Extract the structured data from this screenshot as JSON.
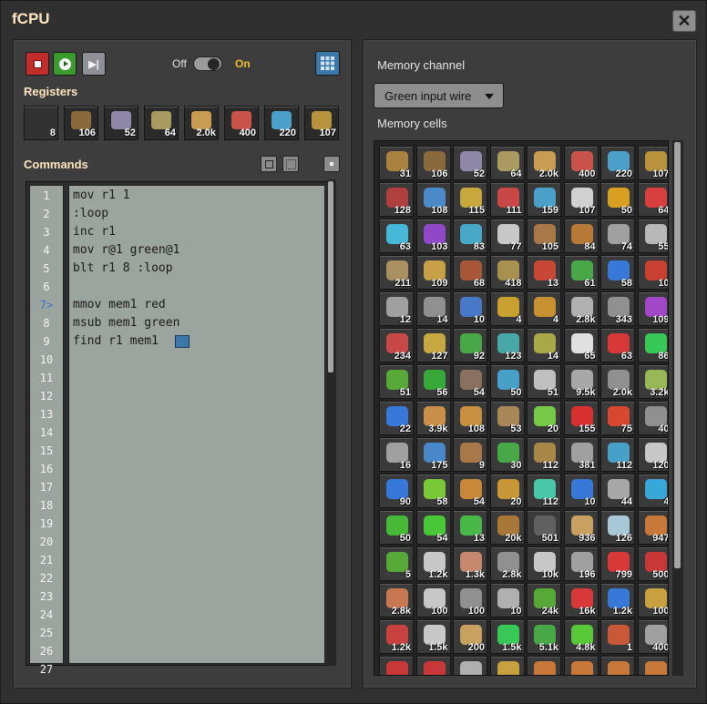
{
  "window": {
    "title": "fCPU",
    "close_label": "✕"
  },
  "controls": {
    "stop_icon": "stop-icon",
    "run_icon": "play-icon",
    "step_icon": "step-icon",
    "power_off": "Off",
    "power_on": "On",
    "power_state": "on",
    "layout_icon": "grid-icon"
  },
  "registers": {
    "heading": "Registers",
    "slots": [
      {
        "icon": "empty",
        "color": "#2a2a2a",
        "count": "8"
      },
      {
        "icon": "wooden-chest-icon",
        "color": "#8a6a3c",
        "count": "106"
      },
      {
        "icon": "steel-chest-icon",
        "color": "#8f88a8",
        "count": "52"
      },
      {
        "icon": "storage-tank-icon",
        "color": "#a99a62",
        "count": "64"
      },
      {
        "icon": "transport-belt-icon",
        "color": "#c89c52",
        "count": "2.0k"
      },
      {
        "icon": "fast-transport-belt-icon",
        "color": "#c9524a",
        "count": "400"
      },
      {
        "icon": "express-transport-belt-icon",
        "color": "#4aa0c9",
        "count": "220"
      },
      {
        "icon": "underground-belt-icon",
        "color": "#b8923c",
        "count": "107"
      }
    ]
  },
  "commands": {
    "heading": "Commands",
    "btn1_icon": "copy-icon",
    "btn2_icon": "select-icon",
    "btn3_icon": "help-icon",
    "current_line": 7,
    "lines": [
      {
        "num": "1",
        "code": "mov r1 1"
      },
      {
        "num": "2",
        "code": ":loop"
      },
      {
        "num": "3",
        "code": "inc r1"
      },
      {
        "num": "4",
        "code": "mov r@1 green@1"
      },
      {
        "num": "5",
        "code": "blt r1 8 :loop"
      },
      {
        "num": "6",
        "code": ""
      },
      {
        "num": "7>",
        "code": "mmov mem1 red"
      },
      {
        "num": "8",
        "code": "msub mem1 green"
      },
      {
        "num": "9",
        "code": "find r1 mem1"
      },
      {
        "num": "10",
        "code": ""
      },
      {
        "num": "11",
        "code": ""
      },
      {
        "num": "12",
        "code": ""
      },
      {
        "num": "13",
        "code": ""
      },
      {
        "num": "14",
        "code": ""
      },
      {
        "num": "15",
        "code": ""
      },
      {
        "num": "16",
        "code": ""
      },
      {
        "num": "17",
        "code": ""
      },
      {
        "num": "18",
        "code": ""
      },
      {
        "num": "19",
        "code": ""
      },
      {
        "num": "20",
        "code": ""
      },
      {
        "num": "21",
        "code": ""
      },
      {
        "num": "22",
        "code": ""
      },
      {
        "num": "23",
        "code": ""
      },
      {
        "num": "24",
        "code": ""
      },
      {
        "num": "25",
        "code": ""
      },
      {
        "num": "26",
        "code": ""
      },
      {
        "num": "27",
        "code": ""
      }
    ]
  },
  "memory": {
    "channel_label": "Memory channel",
    "channel_value": "Green input wire",
    "cells_label": "Memory cells",
    "rows": [
      [
        [
          "31",
          "#a8823e"
        ],
        [
          "106",
          "#8a6a3c"
        ],
        [
          "52",
          "#8f88a8"
        ],
        [
          "64",
          "#a99a62"
        ],
        [
          "2.0k",
          "#c89c52"
        ],
        [
          "400",
          "#c9524a"
        ],
        [
          "220",
          "#4aa0c9"
        ],
        [
          "107",
          "#b8923c"
        ]
      ],
      [
        [
          "128",
          "#b04040"
        ],
        [
          "108",
          "#4a8ac8"
        ],
        [
          "115",
          "#c8a83c"
        ],
        [
          "111",
          "#c84848"
        ],
        [
          "159",
          "#4aa0c9"
        ],
        [
          "107",
          "#d0d0d0"
        ],
        [
          "50",
          "#d8a020"
        ],
        [
          "64",
          "#d84040"
        ]
      ],
      [
        [
          "63",
          "#48b8d8"
        ],
        [
          "103",
          "#9048c8"
        ],
        [
          "83",
          "#48a8c8"
        ],
        [
          "77",
          "#c8c8c8"
        ],
        [
          "105",
          "#a87848"
        ],
        [
          "84",
          "#b87838"
        ],
        [
          "74",
          "#a0a0a0"
        ],
        [
          "55",
          "#b8b8b8"
        ]
      ],
      [
        [
          "211",
          "#a89060"
        ],
        [
          "109",
          "#c8a048"
        ],
        [
          "68",
          "#a85838"
        ],
        [
          "418",
          "#a89050"
        ],
        [
          "13",
          "#c84838"
        ],
        [
          "61",
          "#48a848"
        ],
        [
          "58",
          "#3878d8"
        ],
        [
          "10",
          "#c84030"
        ]
      ],
      [
        [
          "12",
          "#a0a0a0"
        ],
        [
          "14",
          "#909090"
        ],
        [
          "10",
          "#4878c8"
        ],
        [
          "4",
          "#c8a030"
        ],
        [
          "4",
          "#c89030"
        ],
        [
          "2.8k",
          "#b0b0b0"
        ],
        [
          "343",
          "#909090"
        ],
        [
          "109",
          "#a048c8"
        ]
      ],
      [
        [
          "234",
          "#c84848"
        ],
        [
          "127",
          "#c8a840"
        ],
        [
          "92",
          "#48a848"
        ],
        [
          "123",
          "#48a8a8"
        ],
        [
          "14",
          "#a8a848"
        ],
        [
          "65",
          "#e0e0e0"
        ],
        [
          "63",
          "#d83838"
        ],
        [
          "86",
          "#38c858"
        ]
      ],
      [
        [
          "51",
          "#58a838"
        ],
        [
          "56",
          "#38a838"
        ],
        [
          "54",
          "#8a7060"
        ],
        [
          "50",
          "#48a0c8"
        ],
        [
          "51",
          "#c0c0c0"
        ],
        [
          "9.5k",
          "#a8a8a8"
        ],
        [
          "2.0k",
          "#909090"
        ],
        [
          "3.2k",
          "#98b858"
        ]
      ],
      [
        [
          "22",
          "#3878d8"
        ],
        [
          "3.9k",
          "#c89048"
        ],
        [
          "108",
          "#c89040"
        ],
        [
          "53",
          "#a88858"
        ],
        [
          "20",
          "#78c848"
        ],
        [
          "155",
          "#d83030"
        ],
        [
          "75",
          "#d84830"
        ],
        [
          "40",
          "#909090"
        ]
      ],
      [
        [
          "16",
          "#a0a0a0"
        ],
        [
          "175",
          "#4888c8"
        ],
        [
          "9",
          "#a87848"
        ],
        [
          "30",
          "#48a848"
        ],
        [
          "112",
          "#a88848"
        ],
        [
          "381",
          "#a0a0a0"
        ],
        [
          "112",
          "#48a0c8"
        ],
        [
          "120",
          "#c8c8c8"
        ]
      ],
      [
        [
          "90",
          "#3878d8"
        ],
        [
          "58",
          "#78c838"
        ],
        [
          "54",
          "#c88838"
        ],
        [
          "20",
          "#c89838"
        ],
        [
          "112",
          "#48c8a8"
        ],
        [
          "10",
          "#3878d8"
        ],
        [
          "44",
          "#a8a8a8"
        ],
        [
          "4",
          "#38a8d8"
        ]
      ],
      [
        [
          "50",
          "#48b838"
        ],
        [
          "54",
          "#48c838"
        ],
        [
          "13",
          "#48b848"
        ],
        [
          "20k",
          "#a87838"
        ],
        [
          "501",
          "#606060"
        ],
        [
          "936",
          "#c8a060"
        ],
        [
          "126",
          "#a8c8d8"
        ],
        [
          "947",
          "#c87838"
        ]
      ],
      [
        [
          "5",
          "#58a838"
        ],
        [
          "1.2k",
          "#c8c8c8"
        ],
        [
          "1.3k",
          "#c88870"
        ],
        [
          "2.8k",
          "#909090"
        ],
        [
          "10k",
          "#c8c8c8"
        ],
        [
          "196",
          "#a0a0a0"
        ],
        [
          "799",
          "#d83838"
        ],
        [
          "500",
          "#c83838"
        ]
      ],
      [
        [
          "2.8k",
          "#c87850"
        ],
        [
          "100",
          "#c8c8c8"
        ],
        [
          "100",
          "#909090"
        ],
        [
          "10",
          "#b0b0b0"
        ],
        [
          "24k",
          "#58a838"
        ],
        [
          "16k",
          "#d83838"
        ],
        [
          "1.2k",
          "#3878d8"
        ],
        [
          "100",
          "#c8a040"
        ]
      ],
      [
        [
          "1.2k",
          "#c84040"
        ],
        [
          "1.5k",
          "#c8c8c8"
        ],
        [
          "200",
          "#c8a060"
        ],
        [
          "1.5k",
          "#38c858"
        ],
        [
          "5.1k",
          "#48a848"
        ],
        [
          "4.8k",
          "#58c838"
        ],
        [
          "1",
          "#c85838"
        ],
        [
          "400",
          "#a0a0a0"
        ]
      ],
      [
        [
          "",
          "#c83838"
        ],
        [
          "",
          "#c83838"
        ],
        [
          "",
          "#b0b0b0"
        ],
        [
          "",
          "#c8a040"
        ],
        [
          "",
          "#c87838"
        ],
        [
          "",
          "#c87838"
        ],
        [
          "",
          "#c87838"
        ],
        [
          "",
          "#c87838"
        ]
      ]
    ]
  }
}
